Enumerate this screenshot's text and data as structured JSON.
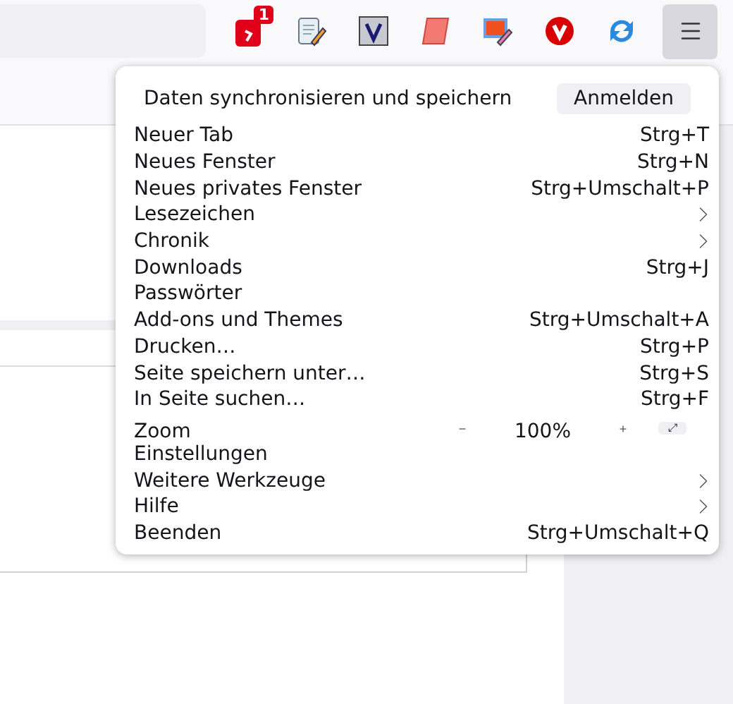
{
  "toolbar": {
    "extensions": [
      {
        "kind": "badge-app",
        "badge": "1"
      },
      {
        "kind": "scroll"
      },
      {
        "kind": "v"
      },
      {
        "kind": "paper"
      },
      {
        "kind": "paint"
      },
      {
        "kind": "vivaldi"
      },
      {
        "kind": "sync"
      }
    ]
  },
  "menu": {
    "header": "Daten synchronisieren und speichern",
    "sign_in": "Anmelden",
    "items": [
      {
        "kind": "item",
        "label": "Neuer Tab",
        "shortcut": "Strg+T"
      },
      {
        "kind": "item",
        "label": "Neues Fenster",
        "shortcut": "Strg+N"
      },
      {
        "kind": "item",
        "label": "Neues privates Fenster",
        "shortcut": "Strg+Umschalt+P"
      },
      {
        "kind": "submenu",
        "label": "Lesezeichen"
      },
      {
        "kind": "submenu",
        "label": "Chronik"
      },
      {
        "kind": "item",
        "label": "Downloads",
        "shortcut": "Strg+J"
      },
      {
        "kind": "item",
        "label": "Passwörter"
      },
      {
        "kind": "item",
        "label": "Add-ons und Themes",
        "shortcut": "Strg+Umschalt+A"
      },
      {
        "kind": "item",
        "label": "Drucken…",
        "shortcut": "Strg+P"
      },
      {
        "kind": "item",
        "label": "Seite speichern unter…",
        "shortcut": "Strg+S"
      },
      {
        "kind": "item",
        "label": "In Seite suchen…",
        "shortcut": "Strg+F"
      },
      {
        "kind": "zoom",
        "label": "Zoom",
        "minus": "−",
        "value": "100%",
        "plus": "+",
        "expand": "⤢"
      },
      {
        "kind": "item",
        "label": "Einstellungen"
      },
      {
        "kind": "submenu",
        "label": "Weitere Werkzeuge"
      },
      {
        "kind": "submenu",
        "label": "Hilfe"
      },
      {
        "kind": "item",
        "label": "Beenden",
        "shortcut": "Strg+Umschalt+Q"
      }
    ]
  }
}
